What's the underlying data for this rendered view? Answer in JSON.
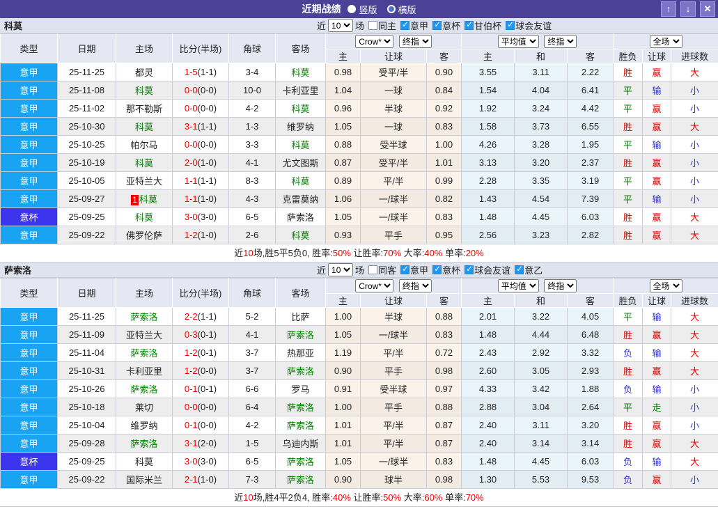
{
  "titlebar": {
    "title": "近期战绩",
    "layout_options": [
      {
        "label": "竖版",
        "selected": true
      },
      {
        "label": "横版",
        "selected": false
      }
    ],
    "up_icon": "↑",
    "down_icon": "↓",
    "close_icon": "✕"
  },
  "colors": {
    "header_purple": "#4b4197",
    "league_blue": "#18a3f3",
    "cup_purple": "#3b35ee",
    "highlight_green": "#008000",
    "score_red": "#ee0000",
    "loss_blue": "#3232cc"
  },
  "labels": {
    "near": "近",
    "games_suffix": "场",
    "left": [
      "类型",
      "日期",
      "主场",
      "比分(半场)",
      "角球",
      "客场"
    ],
    "sub": [
      "主",
      "让球",
      "客",
      "主",
      "和",
      "客",
      "胜负",
      "让球",
      "进球数"
    ]
  },
  "sections": [
    {
      "team": "科莫",
      "games": "10",
      "same_label": "同主",
      "same_checked": false,
      "leagues": [
        {
          "label": "意甲",
          "checked": true
        },
        {
          "label": "意杯",
          "checked": true
        },
        {
          "label": "甘伯杯",
          "checked": true
        },
        {
          "label": "球会友谊",
          "checked": true
        }
      ],
      "selects": {
        "src": "Crow*",
        "fin": "终指",
        "avg": "平均值",
        "avg_fin": "终指",
        "scope": "全场"
      },
      "rows": [
        {
          "league": "意甲",
          "cup": false,
          "date": "25-11-25",
          "home": "都灵",
          "home_hl": false,
          "badge": "",
          "score": "1-5",
          "half": "(1-1)",
          "corner": "3-4",
          "away": "科莫",
          "away_hl": true,
          "ah": [
            "0.98",
            "受平/半",
            "0.90"
          ],
          "eu": [
            "3.55",
            "3.11",
            "2.22"
          ],
          "res": [
            [
              "胜",
              "r"
            ],
            [
              "赢",
              "r"
            ],
            [
              "大",
              "r"
            ]
          ]
        },
        {
          "league": "意甲",
          "cup": false,
          "date": "25-11-08",
          "home": "科莫",
          "home_hl": true,
          "badge": "",
          "score": "0-0",
          "half": "(0-0)",
          "corner": "10-0",
          "away": "卡利亚里",
          "away_hl": false,
          "ah": [
            "1.04",
            "一球",
            "0.84"
          ],
          "eu": [
            "1.54",
            "4.04",
            "6.41"
          ],
          "res": [
            [
              "平",
              "g"
            ],
            [
              "输",
              "b"
            ],
            [
              "小",
              "b"
            ]
          ]
        },
        {
          "league": "意甲",
          "cup": false,
          "date": "25-11-02",
          "home": "那不勒斯",
          "home_hl": false,
          "badge": "",
          "score": "0-0",
          "half": "(0-0)",
          "corner": "4-2",
          "away": "科莫",
          "away_hl": true,
          "ah": [
            "0.96",
            "半球",
            "0.92"
          ],
          "eu": [
            "1.92",
            "3.24",
            "4.42"
          ],
          "res": [
            [
              "平",
              "g"
            ],
            [
              "赢",
              "r"
            ],
            [
              "小",
              "b"
            ]
          ]
        },
        {
          "league": "意甲",
          "cup": false,
          "date": "25-10-30",
          "home": "科莫",
          "home_hl": true,
          "badge": "",
          "score": "3-1",
          "half": "(1-1)",
          "corner": "1-3",
          "away": "维罗纳",
          "away_hl": false,
          "ah": [
            "1.05",
            "一球",
            "0.83"
          ],
          "eu": [
            "1.58",
            "3.73",
            "6.55"
          ],
          "res": [
            [
              "胜",
              "r"
            ],
            [
              "赢",
              "r"
            ],
            [
              "大",
              "r"
            ]
          ]
        },
        {
          "league": "意甲",
          "cup": false,
          "date": "25-10-25",
          "home": "帕尔马",
          "home_hl": false,
          "badge": "",
          "score": "0-0",
          "half": "(0-0)",
          "corner": "3-3",
          "away": "科莫",
          "away_hl": true,
          "ah": [
            "0.88",
            "受半球",
            "1.00"
          ],
          "eu": [
            "4.26",
            "3.28",
            "1.95"
          ],
          "res": [
            [
              "平",
              "g"
            ],
            [
              "输",
              "b"
            ],
            [
              "小",
              "b"
            ]
          ]
        },
        {
          "league": "意甲",
          "cup": false,
          "date": "25-10-19",
          "home": "科莫",
          "home_hl": true,
          "badge": "",
          "score": "2-0",
          "half": "(1-0)",
          "corner": "4-1",
          "away": "尤文图斯",
          "away_hl": false,
          "ah": [
            "0.87",
            "受平/半",
            "1.01"
          ],
          "eu": [
            "3.13",
            "3.20",
            "2.37"
          ],
          "res": [
            [
              "胜",
              "r"
            ],
            [
              "赢",
              "r"
            ],
            [
              "小",
              "b"
            ]
          ]
        },
        {
          "league": "意甲",
          "cup": false,
          "date": "25-10-05",
          "home": "亚特兰大",
          "home_hl": false,
          "badge": "",
          "score": "1-1",
          "half": "(1-1)",
          "corner": "8-3",
          "away": "科莫",
          "away_hl": true,
          "ah": [
            "0.89",
            "平/半",
            "0.99"
          ],
          "eu": [
            "2.28",
            "3.35",
            "3.19"
          ],
          "res": [
            [
              "平",
              "g"
            ],
            [
              "赢",
              "r"
            ],
            [
              "小",
              "b"
            ]
          ]
        },
        {
          "league": "意甲",
          "cup": false,
          "date": "25-09-27",
          "home": "科莫",
          "home_hl": true,
          "badge": "1",
          "score": "1-1",
          "half": "(1-0)",
          "corner": "4-3",
          "away": "克雷莫纳",
          "away_hl": false,
          "ah": [
            "1.06",
            "一/球半",
            "0.82"
          ],
          "eu": [
            "1.43",
            "4.54",
            "7.39"
          ],
          "res": [
            [
              "平",
              "g"
            ],
            [
              "输",
              "b"
            ],
            [
              "小",
              "b"
            ]
          ]
        },
        {
          "league": "意杯",
          "cup": true,
          "date": "25-09-25",
          "home": "科莫",
          "home_hl": true,
          "badge": "",
          "score": "3-0",
          "half": "(3-0)",
          "corner": "6-5",
          "away": "萨索洛",
          "away_hl": false,
          "ah": [
            "1.05",
            "一/球半",
            "0.83"
          ],
          "eu": [
            "1.48",
            "4.45",
            "6.03"
          ],
          "res": [
            [
              "胜",
              "r"
            ],
            [
              "赢",
              "r"
            ],
            [
              "大",
              "r"
            ]
          ]
        },
        {
          "league": "意甲",
          "cup": false,
          "date": "25-09-22",
          "home": "佛罗伦萨",
          "home_hl": false,
          "badge": "",
          "score": "1-2",
          "half": "(1-0)",
          "corner": "2-6",
          "away": "科莫",
          "away_hl": true,
          "ah": [
            "0.93",
            "平手",
            "0.95"
          ],
          "eu": [
            "2.56",
            "3.23",
            "2.82"
          ],
          "res": [
            [
              "胜",
              "r"
            ],
            [
              "赢",
              "r"
            ],
            [
              "大",
              "r"
            ]
          ]
        }
      ],
      "summary": [
        [
          "近",
          0
        ],
        [
          "10",
          1
        ],
        [
          "场,胜5平5负0, 胜率:",
          0
        ],
        [
          "50%",
          1
        ],
        [
          " 让胜率:",
          0
        ],
        [
          "70%",
          1
        ],
        [
          " 大率:",
          0
        ],
        [
          "40%",
          1
        ],
        [
          " 单率:",
          0
        ],
        [
          "20%",
          1
        ]
      ]
    },
    {
      "team": "萨索洛",
      "games": "10",
      "same_label": "同客",
      "same_checked": false,
      "leagues": [
        {
          "label": "意甲",
          "checked": true
        },
        {
          "label": "意杯",
          "checked": true
        },
        {
          "label": "球会友谊",
          "checked": true
        },
        {
          "label": "意乙",
          "checked": true
        }
      ],
      "selects": {
        "src": "Crow*",
        "fin": "终指",
        "avg": "平均值",
        "avg_fin": "终指",
        "scope": "全场"
      },
      "rows": [
        {
          "league": "意甲",
          "cup": false,
          "date": "25-11-25",
          "home": "萨索洛",
          "home_hl": true,
          "badge": "",
          "score": "2-2",
          "half": "(1-1)",
          "corner": "5-2",
          "away": "比萨",
          "away_hl": false,
          "ah": [
            "1.00",
            "半球",
            "0.88"
          ],
          "eu": [
            "2.01",
            "3.22",
            "4.05"
          ],
          "res": [
            [
              "平",
              "g"
            ],
            [
              "输",
              "b"
            ],
            [
              "大",
              "r"
            ]
          ]
        },
        {
          "league": "意甲",
          "cup": false,
          "date": "25-11-09",
          "home": "亚特兰大",
          "home_hl": false,
          "badge": "",
          "score": "0-3",
          "half": "(0-1)",
          "corner": "4-1",
          "away": "萨索洛",
          "away_hl": true,
          "ah": [
            "1.05",
            "一/球半",
            "0.83"
          ],
          "eu": [
            "1.48",
            "4.44",
            "6.48"
          ],
          "res": [
            [
              "胜",
              "r"
            ],
            [
              "赢",
              "r"
            ],
            [
              "大",
              "r"
            ]
          ]
        },
        {
          "league": "意甲",
          "cup": false,
          "date": "25-11-04",
          "home": "萨索洛",
          "home_hl": true,
          "badge": "",
          "score": "1-2",
          "half": "(0-1)",
          "corner": "3-7",
          "away": "热那亚",
          "away_hl": false,
          "ah": [
            "1.19",
            "平/半",
            "0.72"
          ],
          "eu": [
            "2.43",
            "2.92",
            "3.32"
          ],
          "res": [
            [
              "负",
              "b"
            ],
            [
              "输",
              "b"
            ],
            [
              "大",
              "r"
            ]
          ]
        },
        {
          "league": "意甲",
          "cup": false,
          "date": "25-10-31",
          "home": "卡利亚里",
          "home_hl": false,
          "badge": "",
          "score": "1-2",
          "half": "(0-0)",
          "corner": "3-7",
          "away": "萨索洛",
          "away_hl": true,
          "ah": [
            "0.90",
            "平手",
            "0.98"
          ],
          "eu": [
            "2.60",
            "3.05",
            "2.93"
          ],
          "res": [
            [
              "胜",
              "r"
            ],
            [
              "赢",
              "r"
            ],
            [
              "大",
              "r"
            ]
          ]
        },
        {
          "league": "意甲",
          "cup": false,
          "date": "25-10-26",
          "home": "萨索洛",
          "home_hl": true,
          "badge": "",
          "score": "0-1",
          "half": "(0-1)",
          "corner": "6-6",
          "away": "罗马",
          "away_hl": false,
          "ah": [
            "0.91",
            "受半球",
            "0.97"
          ],
          "eu": [
            "4.33",
            "3.42",
            "1.88"
          ],
          "res": [
            [
              "负",
              "b"
            ],
            [
              "输",
              "b"
            ],
            [
              "小",
              "b"
            ]
          ]
        },
        {
          "league": "意甲",
          "cup": false,
          "date": "25-10-18",
          "home": "莱切",
          "home_hl": false,
          "badge": "",
          "score": "0-0",
          "half": "(0-0)",
          "corner": "6-4",
          "away": "萨索洛",
          "away_hl": true,
          "ah": [
            "1.00",
            "平手",
            "0.88"
          ],
          "eu": [
            "2.88",
            "3.04",
            "2.64"
          ],
          "res": [
            [
              "平",
              "g"
            ],
            [
              "走",
              "g"
            ],
            [
              "小",
              "b"
            ]
          ]
        },
        {
          "league": "意甲",
          "cup": false,
          "date": "25-10-04",
          "home": "维罗纳",
          "home_hl": false,
          "badge": "",
          "score": "0-1",
          "half": "(0-0)",
          "corner": "4-2",
          "away": "萨索洛",
          "away_hl": true,
          "ah": [
            "1.01",
            "平/半",
            "0.87"
          ],
          "eu": [
            "2.40",
            "3.11",
            "3.20"
          ],
          "res": [
            [
              "胜",
              "r"
            ],
            [
              "赢",
              "r"
            ],
            [
              "小",
              "b"
            ]
          ]
        },
        {
          "league": "意甲",
          "cup": false,
          "date": "25-09-28",
          "home": "萨索洛",
          "home_hl": true,
          "badge": "",
          "score": "3-1",
          "half": "(2-0)",
          "corner": "1-5",
          "away": "乌迪内斯",
          "away_hl": false,
          "ah": [
            "1.01",
            "平/半",
            "0.87"
          ],
          "eu": [
            "2.40",
            "3.14",
            "3.14"
          ],
          "res": [
            [
              "胜",
              "r"
            ],
            [
              "赢",
              "r"
            ],
            [
              "大",
              "r"
            ]
          ]
        },
        {
          "league": "意杯",
          "cup": true,
          "date": "25-09-25",
          "home": "科莫",
          "home_hl": false,
          "badge": "",
          "score": "3-0",
          "half": "(3-0)",
          "corner": "6-5",
          "away": "萨索洛",
          "away_hl": true,
          "ah": [
            "1.05",
            "一/球半",
            "0.83"
          ],
          "eu": [
            "1.48",
            "4.45",
            "6.03"
          ],
          "res": [
            [
              "负",
              "b"
            ],
            [
              "输",
              "b"
            ],
            [
              "大",
              "r"
            ]
          ]
        },
        {
          "league": "意甲",
          "cup": false,
          "date": "25-09-22",
          "home": "国际米兰",
          "home_hl": false,
          "badge": "",
          "score": "2-1",
          "half": "(1-0)",
          "corner": "7-3",
          "away": "萨索洛",
          "away_hl": true,
          "ah": [
            "0.90",
            "球半",
            "0.98"
          ],
          "eu": [
            "1.30",
            "5.53",
            "9.53"
          ],
          "res": [
            [
              "负",
              "b"
            ],
            [
              "赢",
              "r"
            ],
            [
              "小",
              "b"
            ]
          ]
        }
      ],
      "summary": [
        [
          "近",
          0
        ],
        [
          "10",
          1
        ],
        [
          "场,胜4平2负4, 胜率:",
          0
        ],
        [
          "40%",
          1
        ],
        [
          " 让胜率:",
          0
        ],
        [
          "50%",
          1
        ],
        [
          " 大率:",
          0
        ],
        [
          "60%",
          1
        ],
        [
          " 单率:",
          0
        ],
        [
          "70%",
          1
        ]
      ]
    }
  ]
}
